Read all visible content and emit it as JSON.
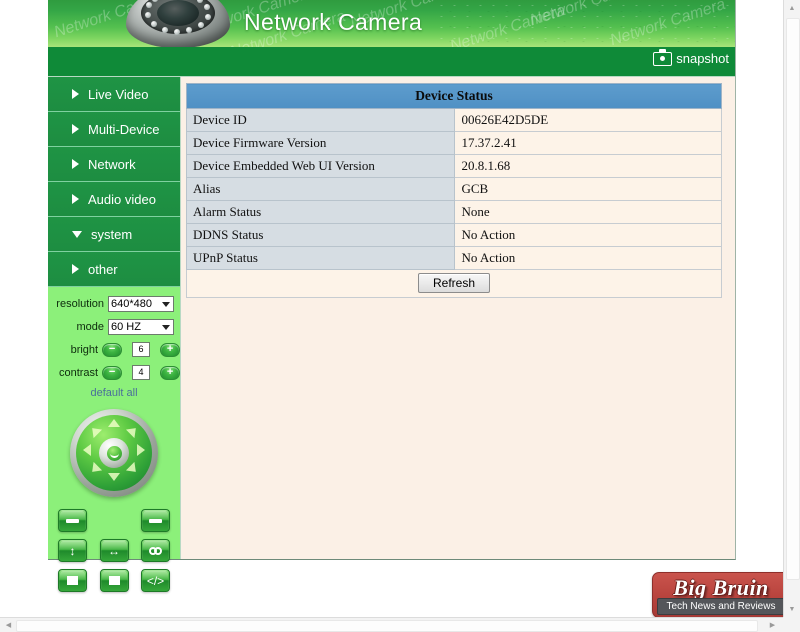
{
  "banner": {
    "title": "Network Camera",
    "watermark": "Network Camera",
    "camera_icon": "dome-camera-image"
  },
  "snapshot_bar": {
    "label": "snapshot",
    "icon": "camera-icon"
  },
  "sidebar": {
    "menu": [
      {
        "label": "Live Video",
        "arrow": "right"
      },
      {
        "label": "Multi-Device",
        "arrow": "right"
      },
      {
        "label": "Network",
        "arrow": "right"
      },
      {
        "label": "Audio video",
        "arrow": "right"
      },
      {
        "label": "system",
        "arrow": "down"
      },
      {
        "label": "other",
        "arrow": "right"
      }
    ],
    "settings": {
      "resolution_label": "resolution",
      "resolution_value": "640*480",
      "mode_label": "mode",
      "mode_value": "60 HZ",
      "bright_label": "bright",
      "bright_value": "6",
      "contrast_label": "contrast",
      "contrast_value": "4",
      "minus_sign": "−",
      "plus_sign": "+",
      "default_all": "default all"
    },
    "ptz": {
      "name": "ptz-joystick",
      "center": "ptz-center-button"
    },
    "buttons": [
      {
        "name": "preset-left-button",
        "icon": "tray-left-icon"
      },
      {
        "name": "preset-right-button",
        "icon": "tray-right-icon"
      },
      {
        "name": "vertical-patrol-button",
        "icon": "up-down-arrow-icon"
      },
      {
        "name": "horizontal-patrol-button",
        "icon": "left-right-arrow-icon"
      },
      {
        "name": "link-button",
        "icon": "chain-link-icon"
      },
      {
        "name": "io-on-button",
        "icon": "white-square-icon"
      },
      {
        "name": "io-off-button",
        "icon": "white-square-icon"
      },
      {
        "name": "code-button",
        "icon": "code-tag-icon"
      }
    ]
  },
  "content": {
    "table": {
      "header": "Device Status",
      "rows": [
        {
          "key": "Device ID",
          "value": "00626E42D5DE"
        },
        {
          "key": "Device Firmware Version",
          "value": "17.37.2.41"
        },
        {
          "key": "Device Embedded Web UI Version",
          "value": "20.8.1.68"
        },
        {
          "key": "Alias",
          "value": "GCB"
        },
        {
          "key": "Alarm Status",
          "value": "None"
        },
        {
          "key": "DDNS Status",
          "value": "No Action"
        },
        {
          "key": "UPnP Status",
          "value": "No Action"
        }
      ],
      "refresh_label": "Refresh"
    }
  },
  "logo": {
    "wordmark": "Big Bruin",
    "tagline": "Tech News and Reviews"
  },
  "scrollbars": {
    "up_arrow": "▲",
    "down_arrow": "▼",
    "left_arrow": "◀",
    "right_arrow": "▶"
  },
  "colors": {
    "banner_green": "#34a646",
    "menu_green": "#1f9445",
    "sidebar_green": "#8cf07a",
    "snapbar_green": "#0f8a38",
    "table_header_blue": "#4f90c4",
    "content_cream": "#fbf0e6",
    "logo_red": "#b8433d"
  }
}
